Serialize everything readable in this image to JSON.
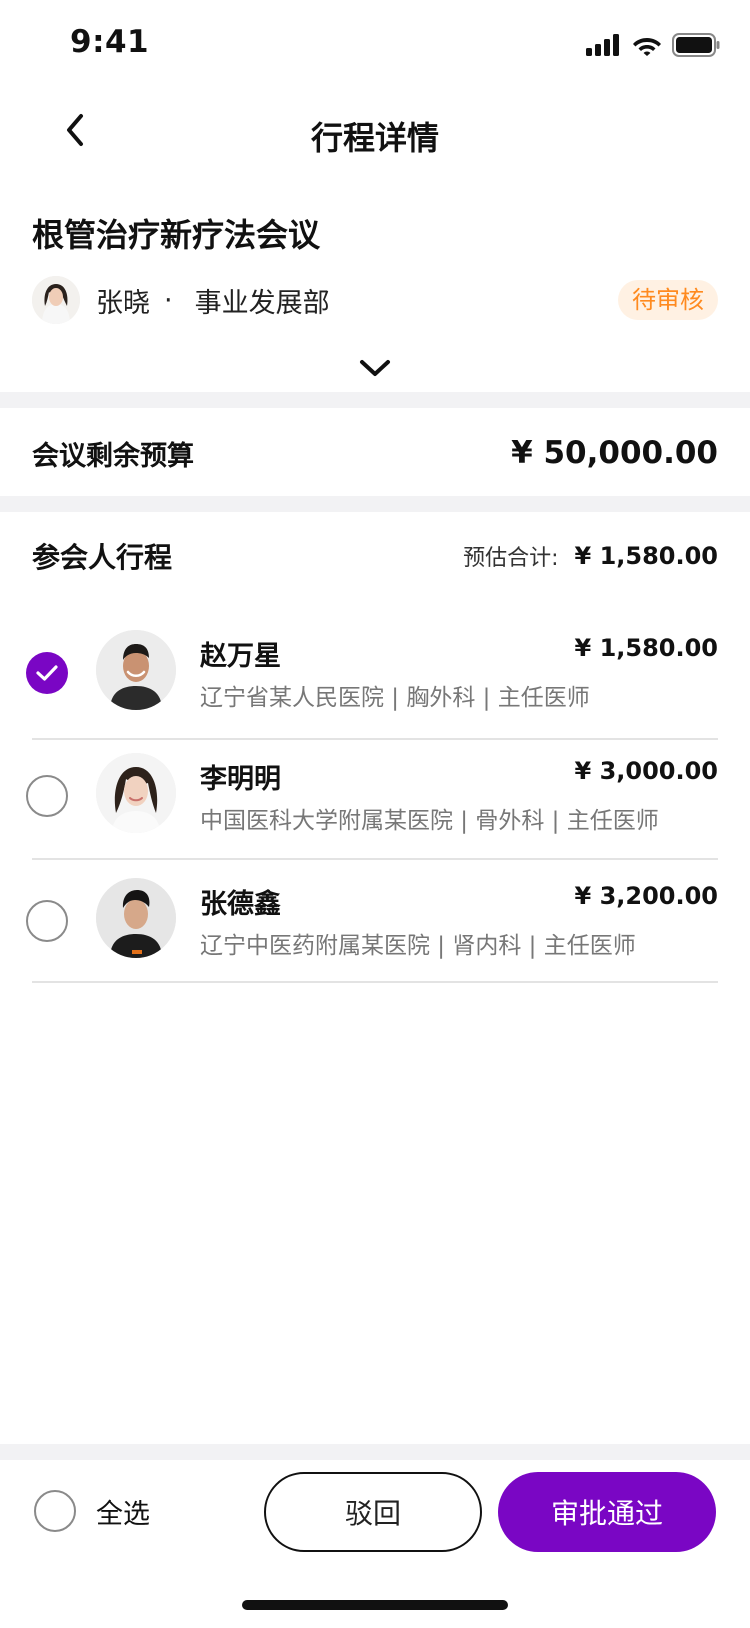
{
  "status_bar": {
    "time": "9:41"
  },
  "nav": {
    "title": "行程详情"
  },
  "meeting": {
    "title": "根管治疗新疗法会议",
    "owner_name": "张晓",
    "separator": "·",
    "department": "事业发展部",
    "status": "待审核"
  },
  "budget": {
    "label": "会议剩余预算",
    "value": "¥ 50,000.00"
  },
  "attendees_section": {
    "title": "参会人行程",
    "estimate_label": "预估合计:",
    "estimate_value": "¥ 1,580.00"
  },
  "attendees": [
    {
      "name": "赵万星",
      "description": "辽宁省某人民医院 | 胸外科 | 主任医师",
      "price": "¥ 1,580.00",
      "selected": true
    },
    {
      "name": "李明明",
      "description": "中国医科大学附属某医院 | 骨外科 | 主任医师",
      "price": "¥ 3,000.00",
      "selected": false
    },
    {
      "name": "张德鑫",
      "description": "辽宁中医药附属某医院 | 肾内科 | 主任医师",
      "price": "¥ 3,200.00",
      "selected": false
    }
  ],
  "bottom_bar": {
    "select_all": "全选",
    "reject": "驳回",
    "approve": "审批通过"
  },
  "colors": {
    "accent": "#7a06c4",
    "badge_text": "#ff8a1f",
    "badge_bg": "#fff1e3",
    "divider": "#f2f2f4"
  }
}
